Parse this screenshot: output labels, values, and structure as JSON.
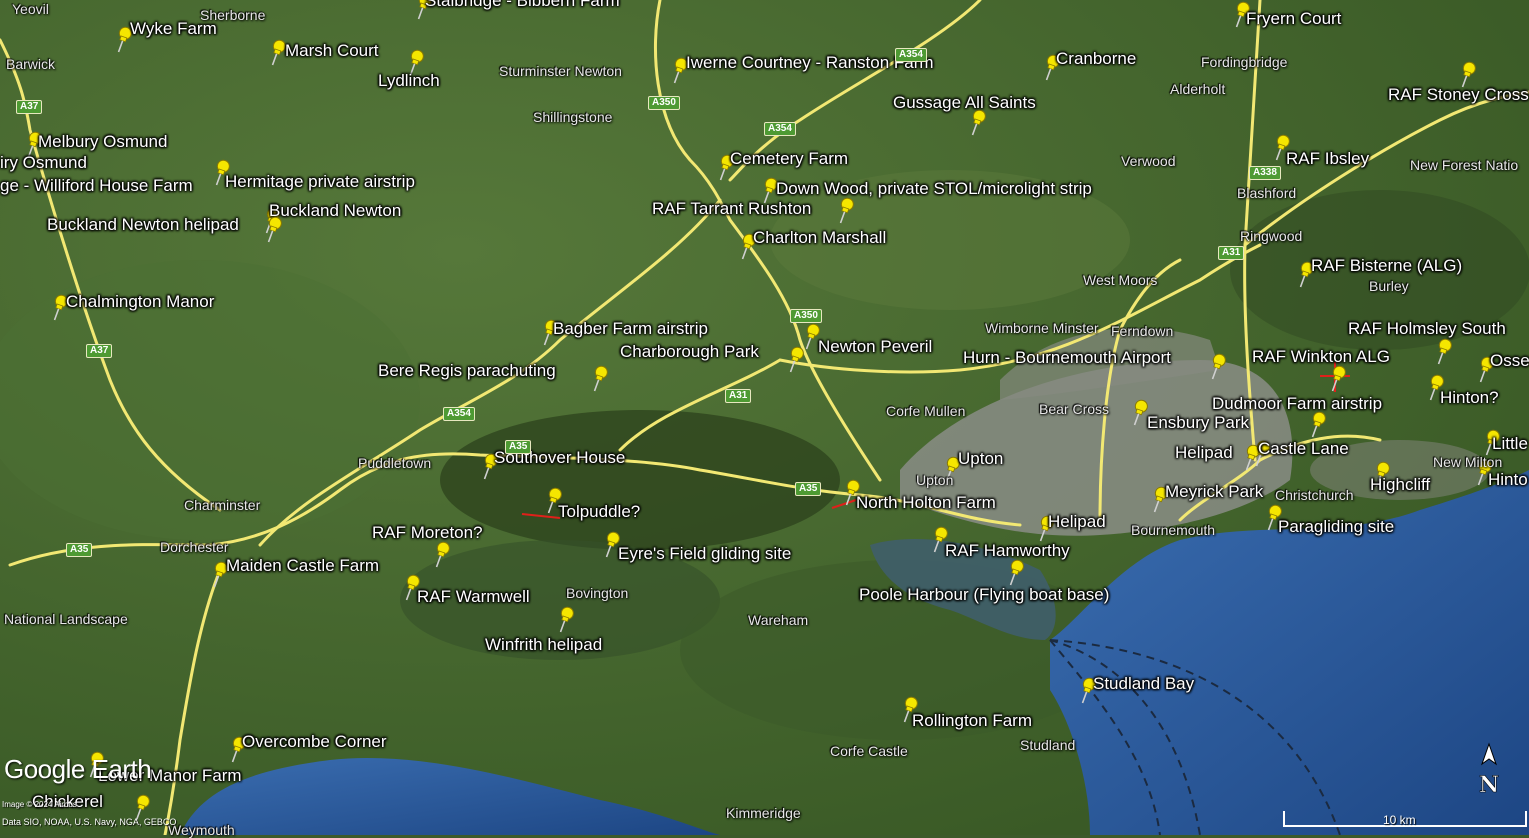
{
  "map": {
    "colors": {
      "land_dark": "#2f4a1f",
      "land": "#4a6b32",
      "urban": "#8a8a80",
      "sea": "#2b5a9a",
      "sea_deep": "#1f4a8a",
      "road_major": "#f2e873",
      "pin": "#f5e600",
      "track": "#e0201a"
    },
    "pins": [
      {
        "id": "wyke-farm",
        "label": "Wyke Farm"
      },
      {
        "id": "marsh-court",
        "label": "Marsh Court"
      },
      {
        "id": "lydlinch",
        "label": "Lydlinch"
      },
      {
        "id": "stalbridge",
        "label": "Stalbridge - Bibbern Farm"
      },
      {
        "id": "iwerne",
        "label": "Iwerne Courtney - Ranston Farm"
      },
      {
        "id": "cranborne",
        "label": "Cranborne"
      },
      {
        "id": "fryern-court",
        "label": "Fryern Court"
      },
      {
        "id": "raf-stoney-cross",
        "label": "RAF Stoney Cross"
      },
      {
        "id": "gussage",
        "label": "Gussage All Saints"
      },
      {
        "id": "melbury",
        "label": "Melbury Osmund"
      },
      {
        "id": "hermitage",
        "label": "Hermitage private airstrip"
      },
      {
        "id": "buckland-newton",
        "label": "Buckland Newton"
      },
      {
        "id": "buckland-heli",
        "label": "Buckland Newton helipad"
      },
      {
        "id": "cemetery-farm",
        "label": "Cemetery Farm"
      },
      {
        "id": "down-wood",
        "label": "Down Wood, private STOL/microlight strip"
      },
      {
        "id": "raf-tarrant",
        "label": "RAF Tarrant Rushton"
      },
      {
        "id": "charlton-marshall",
        "label": "Charlton Marshall"
      },
      {
        "id": "raf-ibsley",
        "label": "RAF Ibsley"
      },
      {
        "id": "raf-bisterne",
        "label": "RAF Bisterne (ALG)"
      },
      {
        "id": "chalmington",
        "label": "Chalmington Manor"
      },
      {
        "id": "bagber",
        "label": "Bagber Farm airstrip"
      },
      {
        "id": "charborough",
        "label": "Charborough Park"
      },
      {
        "id": "newton-peveril",
        "label": "Newton Peveril"
      },
      {
        "id": "hurn",
        "label": "Hurn - Bournemouth Airport"
      },
      {
        "id": "raf-holmsley",
        "label": "RAF Holmsley South"
      },
      {
        "id": "raf-winkton",
        "label": "RAF Winkton ALG"
      },
      {
        "id": "bere-regis",
        "label": "Bere Regis parachuting"
      },
      {
        "id": "dudmoor",
        "label": "Dudmoor Farm airstrip"
      },
      {
        "id": "hinton",
        "label": "Hinton?"
      },
      {
        "id": "ensbury",
        "label": "Ensbury Park"
      },
      {
        "id": "helipad-1",
        "label": "Helipad"
      },
      {
        "id": "castle-lane",
        "label": "Castle Lane"
      },
      {
        "id": "southover",
        "label": "Southover House"
      },
      {
        "id": "upton",
        "label": "Upton"
      },
      {
        "id": "highcliff",
        "label": "Highcliff"
      },
      {
        "id": "tolpuddle",
        "label": "Tolpuddle?"
      },
      {
        "id": "north-holton",
        "label": "North Holton Farm"
      },
      {
        "id": "meyrick",
        "label": "Meyrick Park"
      },
      {
        "id": "raf-moreton",
        "label": "RAF Moreton?"
      },
      {
        "id": "eyres-field",
        "label": "Eyre's Field gliding site"
      },
      {
        "id": "helipad-2",
        "label": "Helipad"
      },
      {
        "id": "paragliding",
        "label": "Paragliding site"
      },
      {
        "id": "maiden-castle",
        "label": "Maiden Castle Farm"
      },
      {
        "id": "raf-hamworthy",
        "label": "RAF Hamworthy"
      },
      {
        "id": "raf-warmwell",
        "label": "RAF Warmwell"
      },
      {
        "id": "poole-harbour",
        "label": "Poole Harbour (Flying boat base)"
      },
      {
        "id": "winfrith",
        "label": "Winfrith helipad"
      },
      {
        "id": "studland-bay",
        "label": "Studland Bay"
      },
      {
        "id": "rollington",
        "label": "Rollington Farm"
      },
      {
        "id": "overcombe",
        "label": "Overcombe Corner"
      },
      {
        "id": "lower-manor",
        "label": "Lower Manor Farm"
      },
      {
        "id": "chickerell",
        "label": "Chickerel"
      },
      {
        "id": "osse",
        "label": "Osse"
      },
      {
        "id": "little",
        "label": "Little"
      },
      {
        "id": "hinto",
        "label": "Hinto"
      },
      {
        "id": "iry-osmund",
        "label": "iry Osmund"
      },
      {
        "id": "williford",
        "label": "ge - Williford House Farm"
      }
    ],
    "places": [
      {
        "id": "yeovil",
        "label": "Yeovil"
      },
      {
        "id": "sherborne",
        "label": "Sherborne"
      },
      {
        "id": "barwick",
        "label": "Barwick"
      },
      {
        "id": "sturminster",
        "label": "Sturminster Newton"
      },
      {
        "id": "shillingstone",
        "label": "Shillingstone"
      },
      {
        "id": "fordingbridge",
        "label": "Fordingbridge"
      },
      {
        "id": "alderholt",
        "label": "Alderholt"
      },
      {
        "id": "verwood",
        "label": "Verwood"
      },
      {
        "id": "blashford",
        "label": "Blashford"
      },
      {
        "id": "new-forest",
        "label": "New Forest Natio"
      },
      {
        "id": "ringwood",
        "label": "Ringwood"
      },
      {
        "id": "west-moors",
        "label": "West Moors"
      },
      {
        "id": "burley",
        "label": "Burley"
      },
      {
        "id": "wimborne",
        "label": "Wimborne Minster"
      },
      {
        "id": "ferndown",
        "label": "Ferndown"
      },
      {
        "id": "corfe-mullen",
        "label": "Corfe Mullen"
      },
      {
        "id": "bear-cross",
        "label": "Bear Cross"
      },
      {
        "id": "puddletown",
        "label": "Puddletown"
      },
      {
        "id": "charminster",
        "label": "Charminster"
      },
      {
        "id": "dorchester",
        "label": "Dorchester"
      },
      {
        "id": "upton-town",
        "label": "Upton"
      },
      {
        "id": "christchurch",
        "label": "Christchurch"
      },
      {
        "id": "bournemouth",
        "label": "Bournemouth"
      },
      {
        "id": "new-milton",
        "label": "New Milton"
      },
      {
        "id": "bovington",
        "label": "Bovington"
      },
      {
        "id": "wareham",
        "label": "Wareham"
      },
      {
        "id": "national-landscape",
        "label": "National Landscape"
      },
      {
        "id": "corfe-castle",
        "label": "Corfe Castle"
      },
      {
        "id": "studland",
        "label": "Studland"
      },
      {
        "id": "kimmeridge",
        "label": "Kimmeridge"
      },
      {
        "id": "weymouth",
        "label": "Weymouth"
      }
    ],
    "roads": [
      {
        "id": "a37-1",
        "label": "A37"
      },
      {
        "id": "a37-2",
        "label": "A37"
      },
      {
        "id": "a350-1",
        "label": "A350"
      },
      {
        "id": "a354-1",
        "label": "A354"
      },
      {
        "id": "a354-2",
        "label": "A354"
      },
      {
        "id": "a338",
        "label": "A338"
      },
      {
        "id": "a31-1",
        "label": "A31"
      },
      {
        "id": "a350-2",
        "label": "A350"
      },
      {
        "id": "a354-3",
        "label": "A354"
      },
      {
        "id": "a31-2",
        "label": "A31"
      },
      {
        "id": "a35-1",
        "label": "A35"
      },
      {
        "id": "a35-2",
        "label": "A35"
      },
      {
        "id": "a35-3",
        "label": "A35"
      }
    ],
    "overlay": {
      "logo": "Google Earth",
      "image_credit": "Image © 2024 Airbus",
      "data_credit": "Data SIO, NOAA, U.S. Navy, NGA, GEBCO",
      "scale_label": "10 km",
      "compass_letter": "N"
    }
  }
}
